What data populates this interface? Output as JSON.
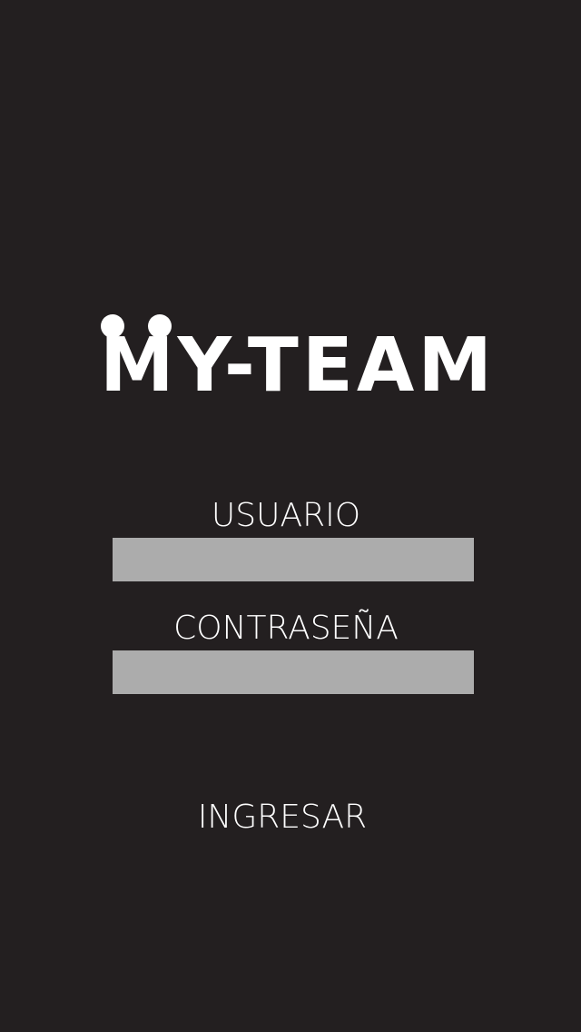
{
  "app": {
    "logo_text": "MY-TEAM"
  },
  "form": {
    "username_label": "USUARIO",
    "username_value": "",
    "password_label": "CONTRASEÑA",
    "password_value": "",
    "submit_label": "INGRESAR"
  },
  "colors": {
    "background": "#231f20",
    "text": "#ffffff",
    "input_fill": "#acacac"
  }
}
